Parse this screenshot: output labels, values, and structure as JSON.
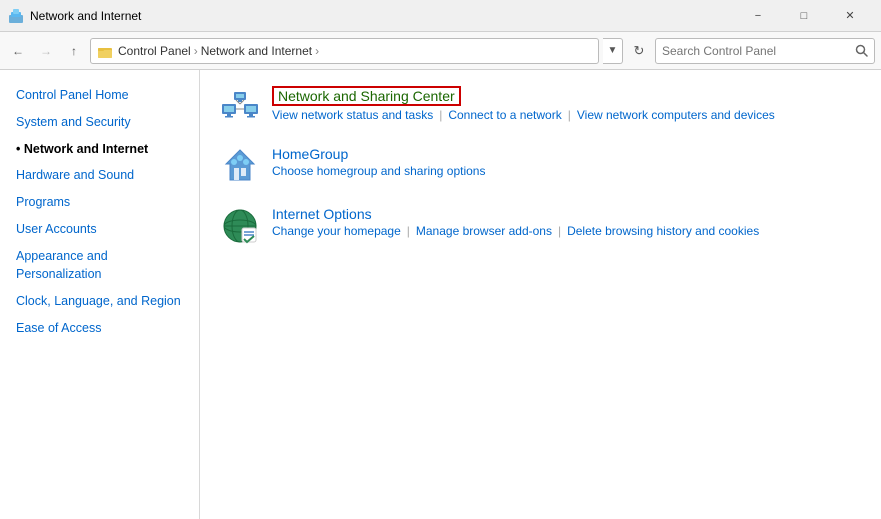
{
  "titleBar": {
    "title": "Network and Internet",
    "icon": "network-icon",
    "minimizeLabel": "−",
    "maximizeLabel": "□",
    "closeLabel": "✕"
  },
  "addressBar": {
    "backLabel": "←",
    "forwardLabel": "→",
    "upLabel": "↑",
    "refreshLabel": "⟳",
    "breadcrumbs": [
      "Control Panel",
      "Network and Internet"
    ],
    "searchPlaceholder": "Search Control Panel"
  },
  "sidebar": {
    "items": [
      {
        "label": "Control Panel Home",
        "active": false,
        "id": "control-panel-home"
      },
      {
        "label": "System and Security",
        "active": false,
        "id": "system-security"
      },
      {
        "label": "Network and Internet",
        "active": true,
        "id": "network-internet"
      },
      {
        "label": "Hardware and Sound",
        "active": false,
        "id": "hardware-sound"
      },
      {
        "label": "Programs",
        "active": false,
        "id": "programs"
      },
      {
        "label": "User Accounts",
        "active": false,
        "id": "user-accounts"
      },
      {
        "label": "Appearance and Personalization",
        "active": false,
        "id": "appearance"
      },
      {
        "label": "Clock, Language, and Region",
        "active": false,
        "id": "clock-language"
      },
      {
        "label": "Ease of Access",
        "active": false,
        "id": "ease-access"
      }
    ]
  },
  "content": {
    "categories": [
      {
        "id": "network-sharing",
        "title": "Network and Sharing Center",
        "highlighted": true,
        "links": [
          {
            "label": "View network status and tasks",
            "id": "view-network-status"
          },
          {
            "label": "Connect to a network",
            "id": "connect-network"
          },
          {
            "label": "View network computers and devices",
            "id": "view-network-computers"
          }
        ]
      },
      {
        "id": "homegroup",
        "title": "HomeGroup",
        "highlighted": false,
        "links": [
          {
            "label": "Choose homegroup and sharing options",
            "id": "homegroup-options"
          }
        ]
      },
      {
        "id": "internet-options",
        "title": "Internet Options",
        "highlighted": false,
        "links": [
          {
            "label": "Change your homepage",
            "id": "change-homepage"
          },
          {
            "label": "Manage browser add-ons",
            "id": "manage-addons"
          },
          {
            "label": "Delete browsing history and cookies",
            "id": "delete-history"
          }
        ]
      }
    ]
  }
}
